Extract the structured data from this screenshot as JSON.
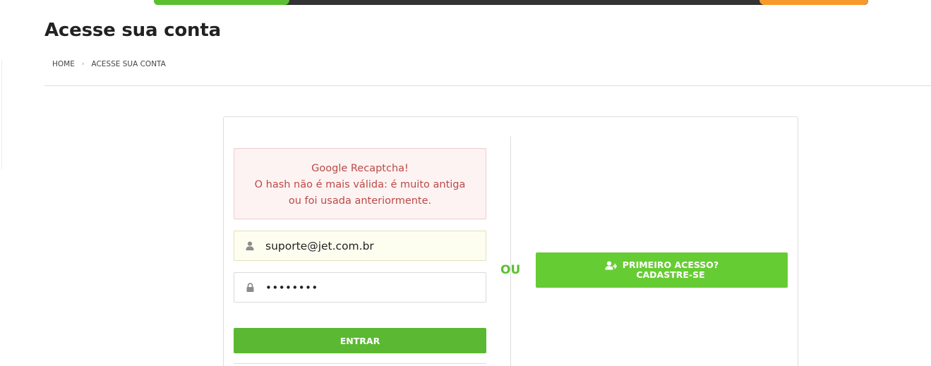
{
  "page": {
    "title": "Acesse sua conta"
  },
  "breadcrumb": {
    "home": "HOME",
    "separator": "›",
    "current": "ACESSE SUA CONTA"
  },
  "alert": {
    "line1": "Google Recaptcha!",
    "line2": "O hash não é mais válida: é muito antiga",
    "line3": "ou foi usada anteriormente."
  },
  "login": {
    "email_value": "suporte@jet.com.br",
    "email_icon": "user-icon",
    "password_value": "••••••••",
    "password_icon": "lock-icon",
    "submit_label": "ENTRAR"
  },
  "divider_text": "OU",
  "register": {
    "icon": "user-plus-icon",
    "line1": "PRIMEIRO ACESSO?",
    "line2": "CADASTRE-SE"
  },
  "colors": {
    "brand_green": "#5cbf31",
    "button_green": "#5bb832",
    "register_green": "#66cc33",
    "accent_orange": "#f89a2a",
    "topbar_dark": "#333333",
    "alert_text": "#b94a48",
    "alert_bg": "#fdf3f2"
  }
}
